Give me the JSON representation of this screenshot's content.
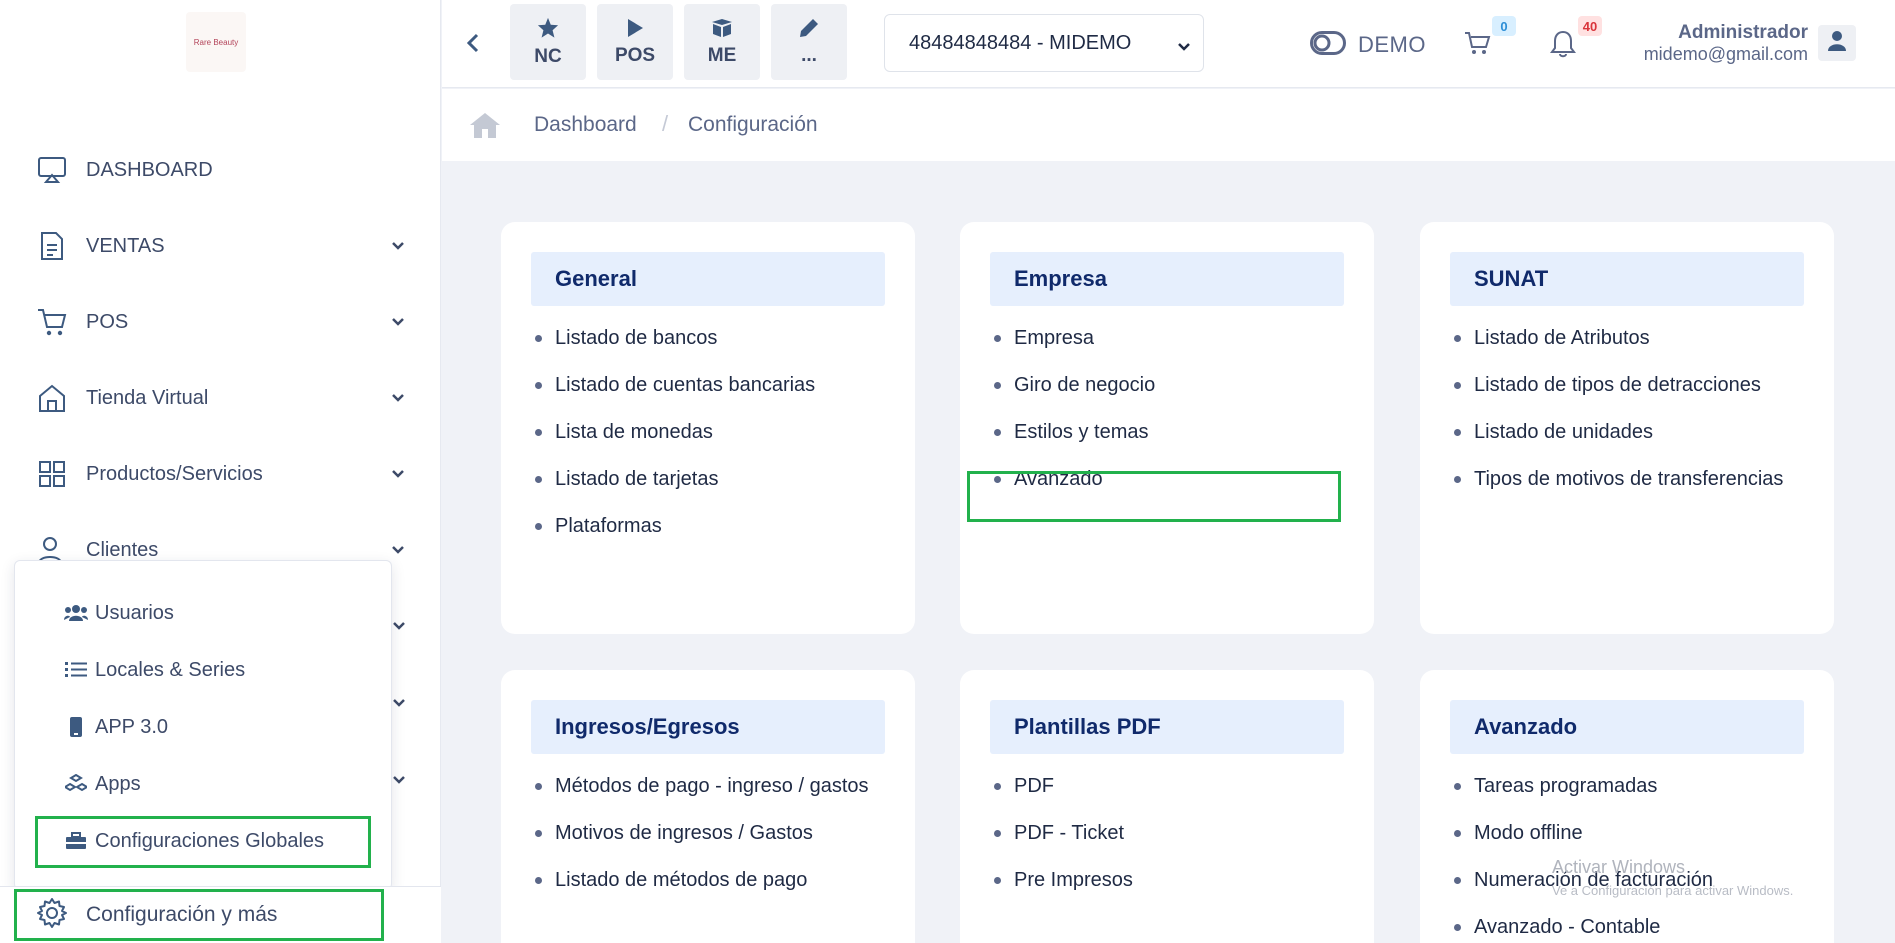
{
  "sidebar": {
    "logo_text": "Rare Beauty",
    "items": [
      {
        "label": "DASHBOARD",
        "icon": "monitor-icon"
      },
      {
        "label": "VENTAS",
        "icon": "document-icon"
      },
      {
        "label": "POS",
        "icon": "cart-icon"
      },
      {
        "label": "Tienda Virtual",
        "icon": "store-icon"
      },
      {
        "label": "Productos/Servicios",
        "icon": "grid-icon"
      },
      {
        "label": "Clientes",
        "icon": "user-icon"
      }
    ],
    "submenu": [
      {
        "label": "Usuarios",
        "icon": "users-icon"
      },
      {
        "label": "Locales & Series",
        "icon": "list-icon"
      },
      {
        "label": "APP 3.0",
        "icon": "mobile-icon"
      },
      {
        "label": "Apps",
        "icon": "cubes-icon"
      },
      {
        "label": "Configuraciones Globales",
        "icon": "toolbox-icon"
      }
    ],
    "bottom_label": "Configuración y más"
  },
  "topbar": {
    "quick_buttons": [
      {
        "label": "NC",
        "icon": "star-icon"
      },
      {
        "label": "POS",
        "icon": "play-icon"
      },
      {
        "label": "ME",
        "icon": "box-icon"
      },
      {
        "label": "...",
        "icon": "pencil-icon"
      }
    ],
    "company": "48484848484 - MIDEMO",
    "demo_label": "DEMO",
    "cart_count": "0",
    "notification_count": "40",
    "user_name": "Administrador",
    "user_email": "midemo@gmail.com"
  },
  "breadcrumb": {
    "items": [
      "Dashboard",
      "Configuración"
    ]
  },
  "cards": [
    {
      "title": "General",
      "items": [
        "Listado de bancos",
        "Listado de cuentas bancarias",
        "Lista de monedas",
        "Listado de tarjetas",
        "Plataformas"
      ]
    },
    {
      "title": "Empresa",
      "items": [
        "Empresa",
        "Giro de negocio",
        "Estilos y temas",
        "Avanzado"
      ]
    },
    {
      "title": "SUNAT",
      "items": [
        "Listado de Atributos",
        "Listado de tipos de detracciones",
        "Listado de unidades",
        "Tipos de motivos de transferencias"
      ]
    },
    {
      "title": "Ingresos/Egresos",
      "items": [
        "Métodos de pago - ingreso / gastos",
        "Motivos de ingresos / Gastos",
        "Listado de métodos de pago"
      ]
    },
    {
      "title": "Plantillas PDF",
      "items": [
        "PDF",
        "PDF - Ticket",
        "Pre Impresos"
      ]
    },
    {
      "title": "Avanzado",
      "items": [
        "Tareas programadas",
        "Modo offline",
        "Numeración de facturación",
        "Avanzado - Contable"
      ]
    }
  ],
  "watermark": {
    "title": "Activar Windows",
    "subtitle": "Ve a Configuración para activar Windows."
  },
  "colors": {
    "highlight": "#22b14c",
    "card_header_bg": "#e6effd",
    "card_header_text": "#102a6b"
  }
}
